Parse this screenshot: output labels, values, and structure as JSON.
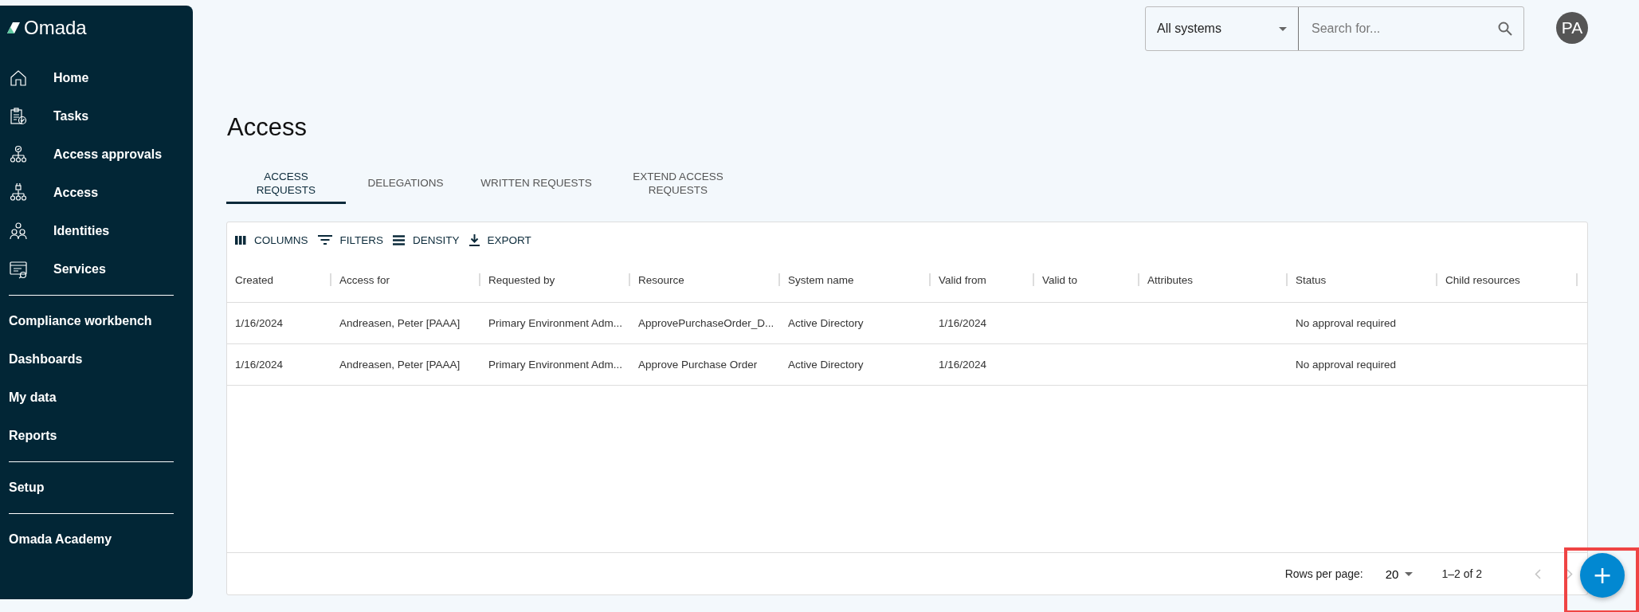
{
  "brand": {
    "name": "Omada"
  },
  "sidebar": {
    "groups": [
      {
        "items": [
          {
            "label": "Home"
          },
          {
            "label": "Tasks"
          },
          {
            "label": "Access approvals"
          },
          {
            "label": "Access"
          },
          {
            "label": "Identities"
          },
          {
            "label": "Services"
          }
        ]
      },
      {
        "items": [
          {
            "label": "Compliance workbench"
          },
          {
            "label": "Dashboards"
          },
          {
            "label": "My data"
          },
          {
            "label": "Reports"
          }
        ]
      },
      {
        "items": [
          {
            "label": "Setup"
          }
        ]
      },
      {
        "items": [
          {
            "label": "Omada Academy"
          }
        ]
      }
    ]
  },
  "topbar": {
    "system_select": "All systems",
    "search": {
      "placeholder": "Search for..."
    },
    "avatar": "PA"
  },
  "page": {
    "title": "Access"
  },
  "tabs": [
    {
      "label": "ACCESS REQUESTS",
      "selected": true
    },
    {
      "label": "DELEGATIONS",
      "selected": false
    },
    {
      "label": "WRITTEN REQUESTS",
      "selected": false
    },
    {
      "label": "EXTEND ACCESS REQUESTS",
      "selected": false
    }
  ],
  "toolbar": [
    {
      "label": "COLUMNS"
    },
    {
      "label": "FILTERS"
    },
    {
      "label": "DENSITY"
    },
    {
      "label": "EXPORT"
    }
  ],
  "table": {
    "columns": [
      "Created",
      "Access for",
      "Requested by",
      "Resource",
      "System name",
      "Valid from",
      "Valid to",
      "Attributes",
      "Status",
      "Child resources"
    ],
    "rows": [
      [
        "1/16/2024",
        "Andreasen, Peter [PAAA]",
        "Primary Environment Adm...",
        "ApprovePurchaseOrder_D...",
        "Active Directory",
        "1/16/2024",
        "",
        "",
        "No approval required",
        ""
      ],
      [
        "1/16/2024",
        "Andreasen, Peter [PAAA]",
        "Primary Environment Adm...",
        "Approve Purchase Order",
        "Active Directory",
        "1/16/2024",
        "",
        "",
        "No approval required",
        ""
      ]
    ]
  },
  "pagination": {
    "rows_per_page_label": "Rows per page:",
    "rows_per_page": "20",
    "range": "1–2 of 2",
    "prev_disabled": true,
    "next_disabled": true
  },
  "fab": {
    "label": "+",
    "highlighted": true
  }
}
